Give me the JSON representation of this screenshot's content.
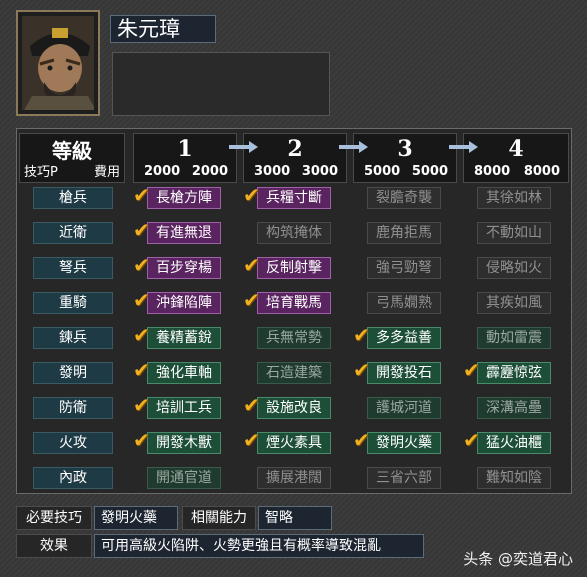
{
  "general": {
    "name": "朱元璋"
  },
  "header": {
    "level_title": "等級",
    "sub_left": "技巧P",
    "sub_right": "費用",
    "levels": [
      {
        "num": "1",
        "cost_left": "2000",
        "cost_right": "2000"
      },
      {
        "num": "2",
        "cost_left": "3000",
        "cost_right": "3000"
      },
      {
        "num": "3",
        "cost_left": "5000",
        "cost_right": "5000"
      },
      {
        "num": "4",
        "cost_left": "8000",
        "cost_right": "8000"
      }
    ]
  },
  "rows": [
    {
      "label": "槍兵",
      "skills": [
        {
          "name": "長槍方陣",
          "state": "purple",
          "checked": true
        },
        {
          "name": "兵糧寸斷",
          "state": "purple",
          "checked": true
        },
        {
          "name": "裂膽奇襲",
          "state": "dim",
          "checked": false
        },
        {
          "name": "其徐如林",
          "state": "dim",
          "checked": false
        }
      ]
    },
    {
      "label": "近衛",
      "skills": [
        {
          "name": "有進無退",
          "state": "purple",
          "checked": true
        },
        {
          "name": "构筑掩体",
          "state": "dim",
          "checked": false
        },
        {
          "name": "鹿角拒馬",
          "state": "dim",
          "checked": false
        },
        {
          "name": "不動如山",
          "state": "dim",
          "checked": false
        }
      ]
    },
    {
      "label": "弩兵",
      "skills": [
        {
          "name": "百步穿楊",
          "state": "purple",
          "checked": true
        },
        {
          "name": "反制射擊",
          "state": "purple",
          "checked": true
        },
        {
          "name": "強弓勁弩",
          "state": "dim",
          "checked": false
        },
        {
          "name": "侵略如火",
          "state": "dim",
          "checked": false
        }
      ]
    },
    {
      "label": "重騎",
      "skills": [
        {
          "name": "沖鋒陷陣",
          "state": "purple",
          "checked": true
        },
        {
          "name": "培育戰馬",
          "state": "purple",
          "checked": true
        },
        {
          "name": "弓馬嫺熟",
          "state": "dim",
          "checked": false
        },
        {
          "name": "其疾如風",
          "state": "dim",
          "checked": false
        }
      ]
    },
    {
      "label": "鍊兵",
      "skills": [
        {
          "name": "養精蓄銳",
          "state": "green",
          "checked": true
        },
        {
          "name": "兵無常勢",
          "state": "dimg",
          "checked": false
        },
        {
          "name": "多多益善",
          "state": "green",
          "checked": true
        },
        {
          "name": "動如雷震",
          "state": "dimg",
          "checked": false
        }
      ]
    },
    {
      "label": "發明",
      "skills": [
        {
          "name": "強化車軸",
          "state": "green",
          "checked": true
        },
        {
          "name": "石造建築",
          "state": "dimg",
          "checked": false
        },
        {
          "name": "開發投石",
          "state": "green",
          "checked": true
        },
        {
          "name": "霹靂惊弦",
          "state": "green",
          "checked": true
        }
      ]
    },
    {
      "label": "防衛",
      "skills": [
        {
          "name": "培訓工兵",
          "state": "green",
          "checked": true
        },
        {
          "name": "設施改良",
          "state": "green",
          "checked": true
        },
        {
          "name": "護城河道",
          "state": "dimg",
          "checked": false
        },
        {
          "name": "深溝高壘",
          "state": "dimg",
          "checked": false
        }
      ]
    },
    {
      "label": "火攻",
      "skills": [
        {
          "name": "開發木獸",
          "state": "green",
          "checked": true
        },
        {
          "name": "煙火素具",
          "state": "green",
          "checked": true
        },
        {
          "name": "發明火藥",
          "state": "green",
          "checked": true
        },
        {
          "name": "猛火油櫃",
          "state": "green",
          "checked": true
        }
      ]
    },
    {
      "label": "內政",
      "skills": [
        {
          "name": "開通官道",
          "state": "dimg",
          "checked": false
        },
        {
          "name": "擴展港闊",
          "state": "dim",
          "checked": false
        },
        {
          "name": "三省六部",
          "state": "dim",
          "checked": false
        },
        {
          "name": "難知如陰",
          "state": "dim",
          "checked": false
        }
      ]
    }
  ],
  "footer": {
    "req_label": "必要技巧",
    "req_value": "發明火藥",
    "ability_label": "相關能力",
    "ability_value": "智略",
    "effect_label": "效果",
    "effect_value": "可用高級火陷阱、火勢更強且有概率導致混亂"
  },
  "watermark": "头条 @奕道君心",
  "colors": {
    "check": "#f0b020",
    "purple": "#5a2460",
    "green": "#1c4e38"
  }
}
